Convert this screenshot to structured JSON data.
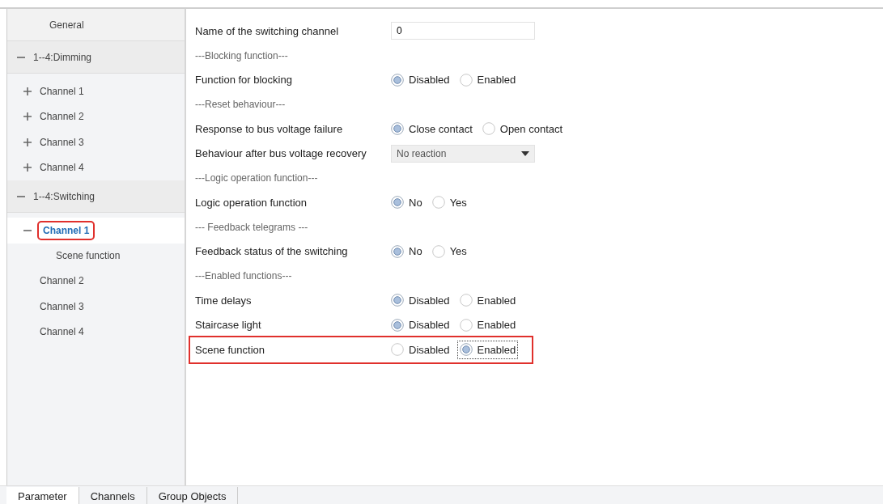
{
  "sidebar": {
    "items": [
      {
        "label": "General",
        "kind": "header",
        "selected": false
      },
      {
        "label": "1--4:Dimming",
        "kind": "group",
        "expanded": true,
        "selected": false,
        "children": [
          {
            "label": "Channel 1",
            "expanded": false,
            "selected": false
          },
          {
            "label": "Channel 2",
            "expanded": false,
            "selected": false
          },
          {
            "label": "Channel 3",
            "expanded": false,
            "selected": false
          },
          {
            "label": "Channel 4",
            "expanded": false,
            "selected": false
          }
        ]
      },
      {
        "label": "1--4:Switching",
        "kind": "group",
        "expanded": true,
        "selected": false,
        "children": [
          {
            "label": "Channel 1",
            "expanded": true,
            "selected": true,
            "highlighted": true,
            "children": [
              {
                "label": "Scene function",
                "selected": false
              }
            ]
          },
          {
            "label": "Channel 2",
            "selected": false
          },
          {
            "label": "Channel 3",
            "selected": false
          },
          {
            "label": "Channel 4",
            "selected": false
          }
        ]
      }
    ]
  },
  "parameters": [
    {
      "kind": "text",
      "label": "Name of the switching channel",
      "value": "0"
    },
    {
      "kind": "heading",
      "label": "---Blocking function---"
    },
    {
      "kind": "radio",
      "label": "Function for blocking",
      "options": [
        {
          "label": "Disabled",
          "selected": true
        },
        {
          "label": "Enabled",
          "selected": false
        }
      ]
    },
    {
      "kind": "heading",
      "label": "---Reset behaviour---"
    },
    {
      "kind": "radio",
      "label": "Response to bus voltage failure",
      "options": [
        {
          "label": "Close contact",
          "selected": true
        },
        {
          "label": "Open contact",
          "selected": false
        }
      ]
    },
    {
      "kind": "select",
      "label": "Behaviour after bus voltage recovery",
      "value": "No reaction"
    },
    {
      "kind": "heading",
      "label": "---Logic operation function---"
    },
    {
      "kind": "radio",
      "label": "Logic operation function",
      "options": [
        {
          "label": "No",
          "selected": true
        },
        {
          "label": "Yes",
          "selected": false
        }
      ]
    },
    {
      "kind": "heading",
      "label": "--- Feedback telegrams ---"
    },
    {
      "kind": "radio",
      "label": "Feedback status of the switching",
      "options": [
        {
          "label": "No",
          "selected": true
        },
        {
          "label": "Yes",
          "selected": false
        }
      ]
    },
    {
      "kind": "heading",
      "label": "---Enabled functions---"
    },
    {
      "kind": "radio",
      "label": "Time delays",
      "options": [
        {
          "label": "Disabled",
          "selected": true
        },
        {
          "label": "Enabled",
          "selected": false
        }
      ]
    },
    {
      "kind": "radio",
      "label": "Staircase light",
      "options": [
        {
          "label": "Disabled",
          "selected": true
        },
        {
          "label": "Enabled",
          "selected": false
        }
      ]
    },
    {
      "kind": "radio",
      "label": "Scene function",
      "highlighted": true,
      "options": [
        {
          "label": "Disabled",
          "selected": false
        },
        {
          "label": "Enabled",
          "selected": true,
          "focused": true
        }
      ]
    }
  ],
  "bottom_tabs": [
    {
      "label": "Parameter",
      "selected": true
    },
    {
      "label": "Channels",
      "selected": false
    },
    {
      "label": "Group Objects",
      "selected": false
    }
  ]
}
